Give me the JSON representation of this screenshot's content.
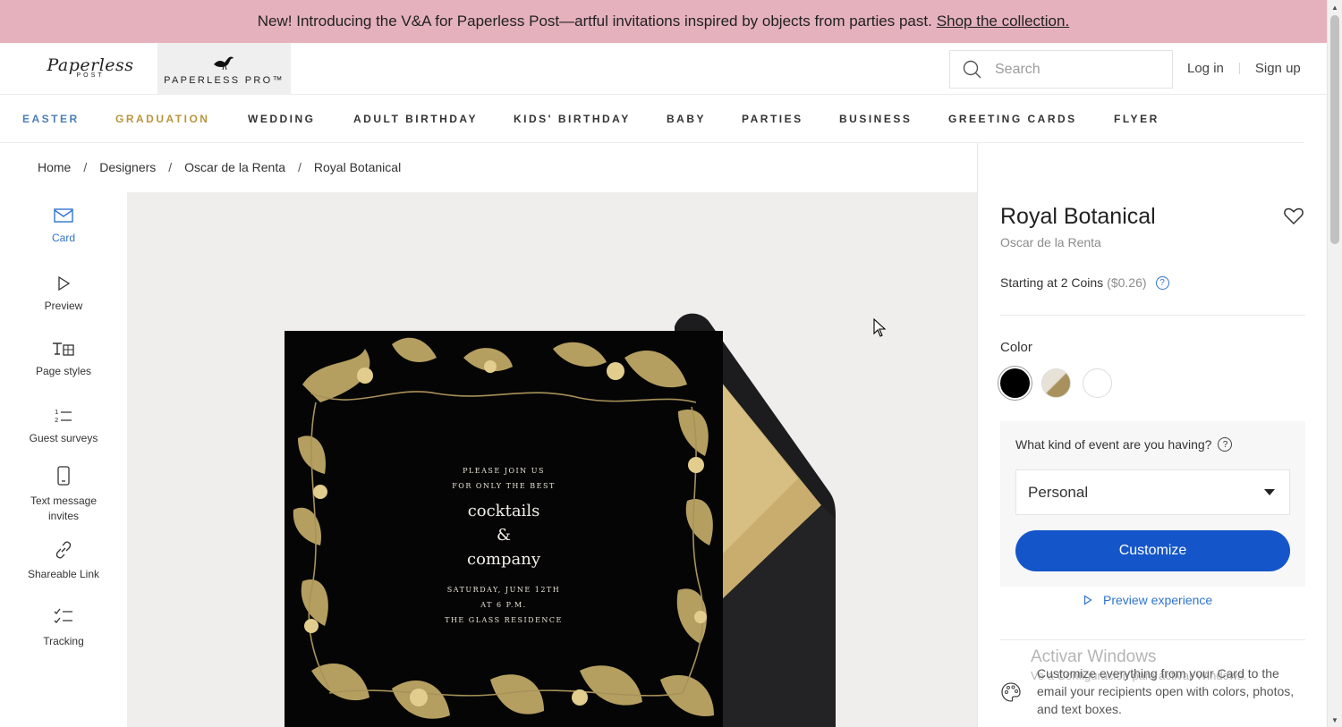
{
  "banner": {
    "text": "New! Introducing the V&A for Paperless Post—artful invitations inspired by objects from parties past.",
    "link": "Shop the collection."
  },
  "header": {
    "logo_script": "Paperless",
    "logo_sub": "POST",
    "pro_label": "PAPERLESS PRO™",
    "search_placeholder": "Search",
    "login": "Log in",
    "signup": "Sign up"
  },
  "nav": {
    "items": [
      {
        "label": "EASTER",
        "color": "#4a7fb8"
      },
      {
        "label": "GRADUATION",
        "color": "#b8963e"
      },
      {
        "label": "WEDDING",
        "color": "#333333"
      },
      {
        "label": "ADULT BIRTHDAY",
        "color": "#333333"
      },
      {
        "label": "KIDS' BIRTHDAY",
        "color": "#333333"
      },
      {
        "label": "BABY",
        "color": "#333333"
      },
      {
        "label": "PARTIES",
        "color": "#333333"
      },
      {
        "label": "BUSINESS",
        "color": "#333333"
      },
      {
        "label": "GREETING CARDS",
        "color": "#333333"
      },
      {
        "label": "FLYER",
        "color": "#333333"
      }
    ]
  },
  "breadcrumb": [
    "Home",
    "Designers",
    "Oscar de la Renta",
    "Royal Botanical"
  ],
  "tools": [
    {
      "label": "Card",
      "icon": "envelope-icon",
      "active": true
    },
    {
      "label": "Preview",
      "icon": "play-icon"
    },
    {
      "label": "Page styles",
      "icon": "page-styles-icon"
    },
    {
      "label": "Guest surveys",
      "icon": "numbered-list-icon"
    },
    {
      "label": "Text message invites",
      "icon": "phone-icon"
    },
    {
      "label": "Shareable Link",
      "icon": "link-icon"
    },
    {
      "label": "Tracking",
      "icon": "checklist-icon"
    }
  ],
  "card": {
    "line1": "PLEASE JOIN US",
    "line2": "FOR ONLY THE BEST",
    "main1": "cocktails",
    "main2": "&",
    "main3": "company",
    "date": "SATURDAY, JUNE 12TH",
    "time": "AT 6 P.M.",
    "place": "THE GLASS RESIDENCE"
  },
  "product": {
    "title": "Royal Botanical",
    "designer": "Oscar de la Renta",
    "price_text": "Starting at 2 Coins",
    "price_usd": "($0.26)",
    "price_help": "?",
    "color_label": "Color",
    "swatches": [
      "#000000",
      "#b4a07a",
      "#ffffff"
    ],
    "event_question": "What kind of event are you having?",
    "event_help": "?",
    "event_value": "Personal",
    "customize": "Customize",
    "preview_experience": "Preview experience",
    "feature_text": "Customize everything from your Card to the email your recipients open with colors, photos, and text boxes."
  },
  "watermark": {
    "line1": "Activar Windows",
    "line2": "Ve a Configuración para activar Windows."
  }
}
